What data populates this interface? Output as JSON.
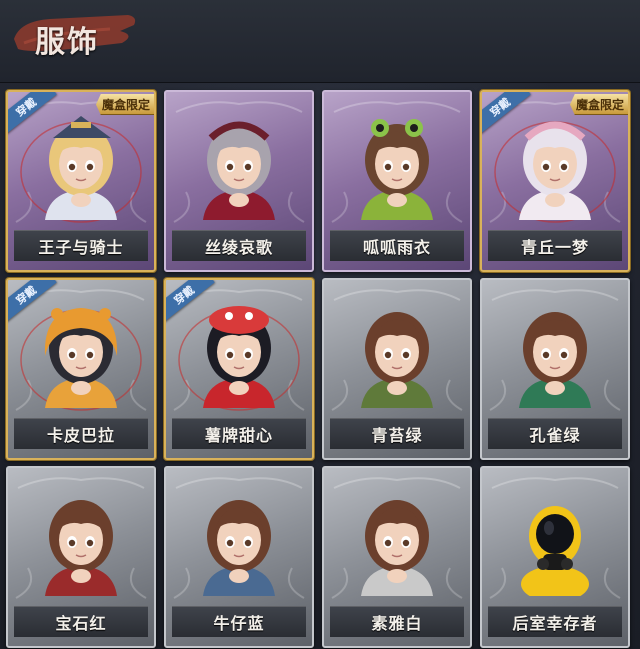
{
  "header": {
    "title": "服饰"
  },
  "cards": [
    {
      "name": "王子与骑士",
      "frame": "purple",
      "worn_badge": "穿戴",
      "limited_badge": "魔盒限定",
      "hair": "#e9c77a",
      "outfit": "#dfe3ee",
      "hat": "#3d4a66"
    },
    {
      "name": "丝绫哀歌",
      "frame": "purple",
      "worn_badge": "",
      "limited_badge": "",
      "hair": "#a8a3ad",
      "outfit": "#8e1b2e",
      "hat": "#6b1f2c"
    },
    {
      "name": "呱呱雨衣",
      "frame": "purple",
      "worn_badge": "",
      "limited_badge": "",
      "hair": "#6a4530",
      "outfit": "#8bb33a",
      "hat": "#8bc34a"
    },
    {
      "name": "青丘一梦",
      "frame": "purple",
      "worn_badge": "穿戴",
      "limited_badge": "魔盒限定",
      "hair": "#e8e2ec",
      "outfit": "#f1eaf1",
      "hat": "#e6a8c0"
    },
    {
      "name": "卡皮巴拉",
      "frame": "gray",
      "worn_badge": "穿戴",
      "limited_badge": "",
      "hair": "#2b2b33",
      "outfit": "#e8a23a",
      "hat": "#e89a30"
    },
    {
      "name": "薯牌甜心",
      "frame": "gray",
      "worn_badge": "穿戴",
      "limited_badge": "",
      "hair": "#1c1c24",
      "outfit": "#c8262c",
      "hat": "#d93a3a"
    },
    {
      "name": "青苔绿",
      "frame": "gray",
      "worn_badge": "",
      "limited_badge": "",
      "hair": "#6b3f2c",
      "outfit": "#5f7a3a",
      "hat": ""
    },
    {
      "name": "孔雀绿",
      "frame": "gray",
      "worn_badge": "",
      "limited_badge": "",
      "hair": "#6b3f2c",
      "outfit": "#2f7a56",
      "hat": ""
    },
    {
      "name": "宝石红",
      "frame": "gray",
      "worn_badge": "",
      "limited_badge": "",
      "hair": "#6b3f2c",
      "outfit": "#9a2b2b",
      "hat": ""
    },
    {
      "name": "牛仔蓝",
      "frame": "gray",
      "worn_badge": "",
      "limited_badge": "",
      "hair": "#6b3f2c",
      "outfit": "#4a6a92",
      "hat": ""
    },
    {
      "name": "素雅白",
      "frame": "gray",
      "worn_badge": "",
      "limited_badge": "",
      "hair": "#6b3f2c",
      "outfit": "#c9c9c9",
      "hat": ""
    },
    {
      "name": "后室幸存者",
      "frame": "gray",
      "worn_badge": "",
      "limited_badge": "",
      "hair": "",
      "outfit": "#f2c418",
      "hat": "#f2c418"
    }
  ]
}
